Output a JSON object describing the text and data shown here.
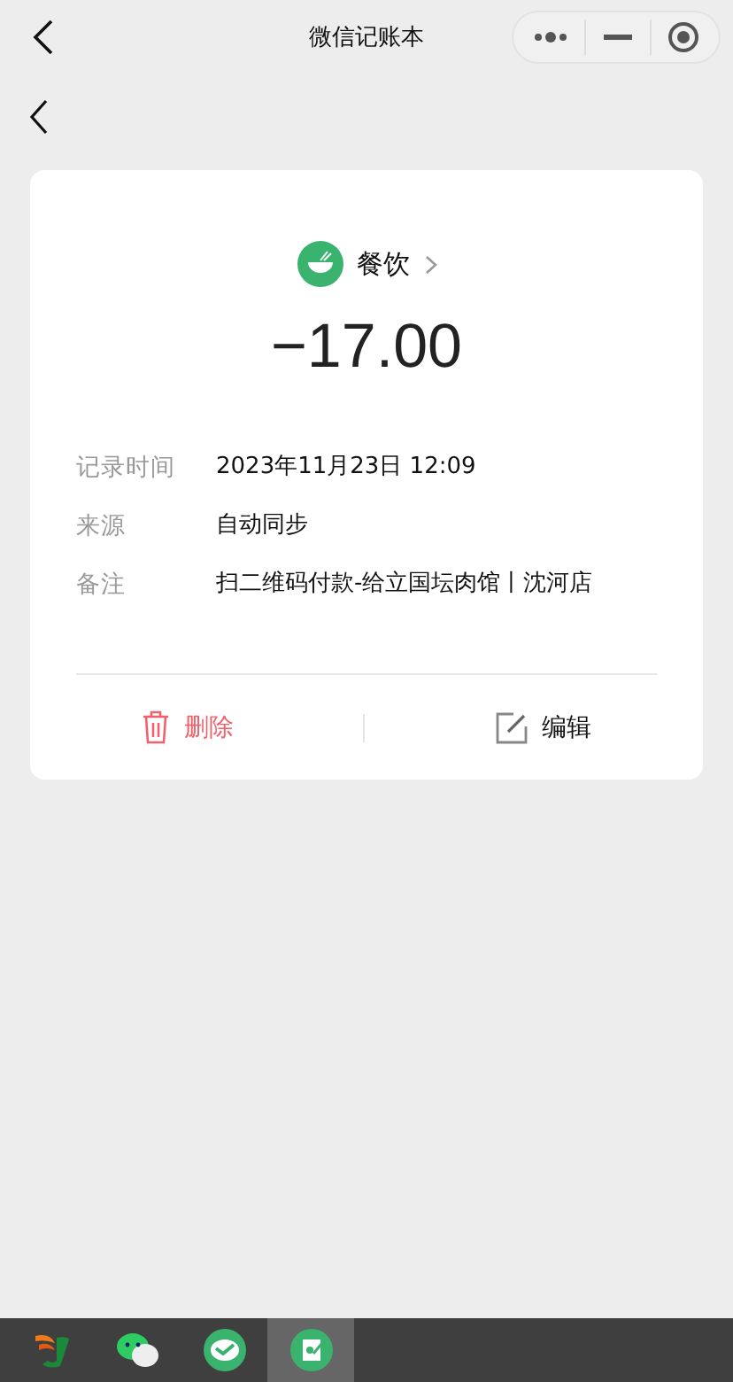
{
  "nav_bar": {
    "title": "微信记账本"
  },
  "record": {
    "category": "餐饮",
    "amount": "−17.00",
    "details": [
      {
        "label": "记录时间",
        "value": "2023年11月23日 12:09"
      },
      {
        "label": "来源",
        "value": "自动同步"
      },
      {
        "label": "备注",
        "value": "扫二维码付款-给立国坛肉馆丨沈河店"
      }
    ],
    "actions": [
      {
        "kind": "delete",
        "label": "删除"
      },
      {
        "kind": "edit",
        "label": "编辑"
      }
    ]
  },
  "taskbar": [
    {
      "kind": "logo",
      "selected": false
    },
    {
      "kind": "chat",
      "selected": false
    },
    {
      "kind": "pay",
      "selected": false
    },
    {
      "kind": "ledger",
      "selected": true
    }
  ]
}
